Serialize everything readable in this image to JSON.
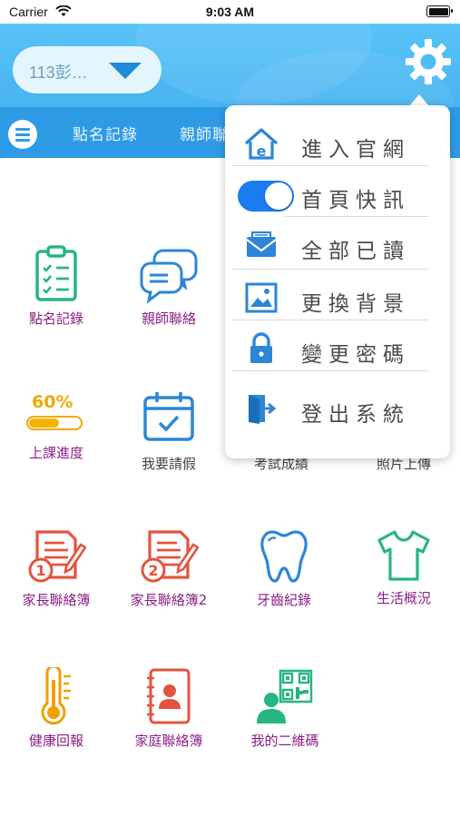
{
  "status_bar": {
    "carrier": "Carrier",
    "time": "9:03 AM"
  },
  "header": {
    "school_selector": "113彭…"
  },
  "tabs": [
    "點名記錄",
    "親師聯"
  ],
  "grid": [
    {
      "label": "點名記錄",
      "icon": "clipboard-checklist-icon"
    },
    {
      "label": "親師聯絡",
      "icon": "chat-bubbles-icon"
    },
    {
      "label": "上課進度",
      "icon": "progress-bar-icon",
      "progress_text": "60%",
      "progress_value": 0.6
    },
    {
      "label": "我要請假",
      "icon": "calendar-check-icon"
    },
    {
      "label": "考試成績",
      "icon": "exam-icon"
    },
    {
      "label": "照片上傳",
      "icon": "photo-upload-icon"
    },
    {
      "label": "家長聯絡簿",
      "icon": "notebook-1-icon",
      "badge": "1"
    },
    {
      "label": "家長聯絡簿2",
      "icon": "notebook-2-icon",
      "badge": "2"
    },
    {
      "label": "牙齒紀錄",
      "icon": "tooth-icon"
    },
    {
      "label": "生活概況",
      "icon": "tshirt-icon"
    },
    {
      "label": "健康回報",
      "icon": "thermometer-icon"
    },
    {
      "label": "家庭聯絡簿",
      "icon": "contact-book-icon"
    },
    {
      "label": "我的二維碼",
      "icon": "qr-code-user-icon"
    }
  ],
  "popup_menu": [
    {
      "label": "進入官網",
      "icon": "home-website-icon"
    },
    {
      "label": "首頁快訊",
      "icon": "toggle-switch",
      "toggle_on": true
    },
    {
      "label": "全部已讀",
      "icon": "envelope-icon"
    },
    {
      "label": "更換背景",
      "icon": "image-icon"
    },
    {
      "label": "變更密碼",
      "icon": "lock-icon"
    },
    {
      "label": "登出系統",
      "icon": "logout-door-icon"
    }
  ],
  "colors": {
    "header": "#4fbcf5",
    "tabbar": "#2e9be6",
    "label": "#8b1f86",
    "accent": "#1f8bd6"
  }
}
